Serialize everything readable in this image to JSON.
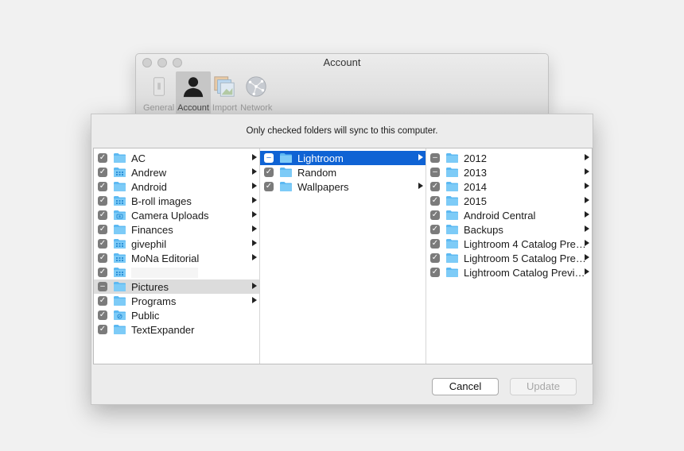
{
  "window": {
    "title": "Account",
    "toolbar": [
      {
        "label": "General",
        "icon": "general-icon",
        "active": false
      },
      {
        "label": "Account",
        "icon": "account-icon",
        "active": true
      },
      {
        "label": "Import",
        "icon": "import-icon",
        "active": false
      },
      {
        "label": "Network",
        "icon": "network-icon",
        "active": false
      }
    ]
  },
  "sheet": {
    "message": "Only checked folders will sync to this computer.",
    "columns": [
      [
        {
          "label": "AC",
          "check": "checked",
          "icon": "folder-icon",
          "arrow": true
        },
        {
          "label": "Andrew",
          "check": "checked",
          "icon": "shared-folder-icon",
          "arrow": true
        },
        {
          "label": "Android",
          "check": "checked",
          "icon": "folder-icon",
          "arrow": true
        },
        {
          "label": "B-roll images",
          "check": "checked",
          "icon": "shared-folder-icon",
          "arrow": true
        },
        {
          "label": "Camera Uploads",
          "check": "checked",
          "icon": "camera-folder-icon",
          "arrow": true
        },
        {
          "label": "Finances",
          "check": "checked",
          "icon": "folder-icon",
          "arrow": true
        },
        {
          "label": "givephil",
          "check": "checked",
          "icon": "shared-folder-icon",
          "arrow": true
        },
        {
          "label": "MoNa Editorial",
          "check": "checked",
          "icon": "shared-folder-icon",
          "arrow": true
        },
        {
          "label": "",
          "check": "checked",
          "icon": "shared-folder-icon",
          "arrow": false,
          "blank": true
        },
        {
          "label": "Pictures",
          "check": "mixed",
          "icon": "folder-icon",
          "arrow": true,
          "selected": "gray"
        },
        {
          "label": "Programs",
          "check": "checked",
          "icon": "folder-icon",
          "arrow": true
        },
        {
          "label": "Public",
          "check": "checked",
          "icon": "public-folder-icon",
          "arrow": false
        },
        {
          "label": "TextExpander",
          "check": "checked",
          "icon": "folder-icon",
          "arrow": false
        }
      ],
      [
        {
          "label": "Lightroom",
          "check": "mixed",
          "icon": "folder-icon",
          "arrow": true,
          "selected": "blue"
        },
        {
          "label": "Random",
          "check": "checked",
          "icon": "folder-icon",
          "arrow": false
        },
        {
          "label": "Wallpapers",
          "check": "checked",
          "icon": "folder-icon",
          "arrow": true
        }
      ],
      [
        {
          "label": "2012",
          "check": "mixed",
          "icon": "folder-icon",
          "arrow": true
        },
        {
          "label": "2013",
          "check": "mixed",
          "icon": "folder-icon",
          "arrow": true
        },
        {
          "label": "2014",
          "check": "checked",
          "icon": "folder-icon",
          "arrow": true
        },
        {
          "label": "2015",
          "check": "checked",
          "icon": "folder-icon",
          "arrow": true
        },
        {
          "label": "Android Central",
          "check": "checked",
          "icon": "folder-icon",
          "arrow": true
        },
        {
          "label": "Backups",
          "check": "checked",
          "icon": "folder-icon",
          "arrow": true
        },
        {
          "label": "Lightroom 4 Catalog Pre…",
          "check": "checked",
          "icon": "folder-icon",
          "arrow": true
        },
        {
          "label": "Lightroom 5 Catalog Pre…",
          "check": "checked",
          "icon": "folder-icon",
          "arrow": true
        },
        {
          "label": "Lightroom Catalog Previ…",
          "check": "checked",
          "icon": "folder-icon",
          "arrow": true
        }
      ]
    ],
    "cancel_label": "Cancel",
    "update_label": "Update"
  },
  "colors": {
    "selection_blue": "#0f63d4",
    "folder_blue": "#5cb9f2",
    "selection_gray": "#dcdcdc"
  }
}
